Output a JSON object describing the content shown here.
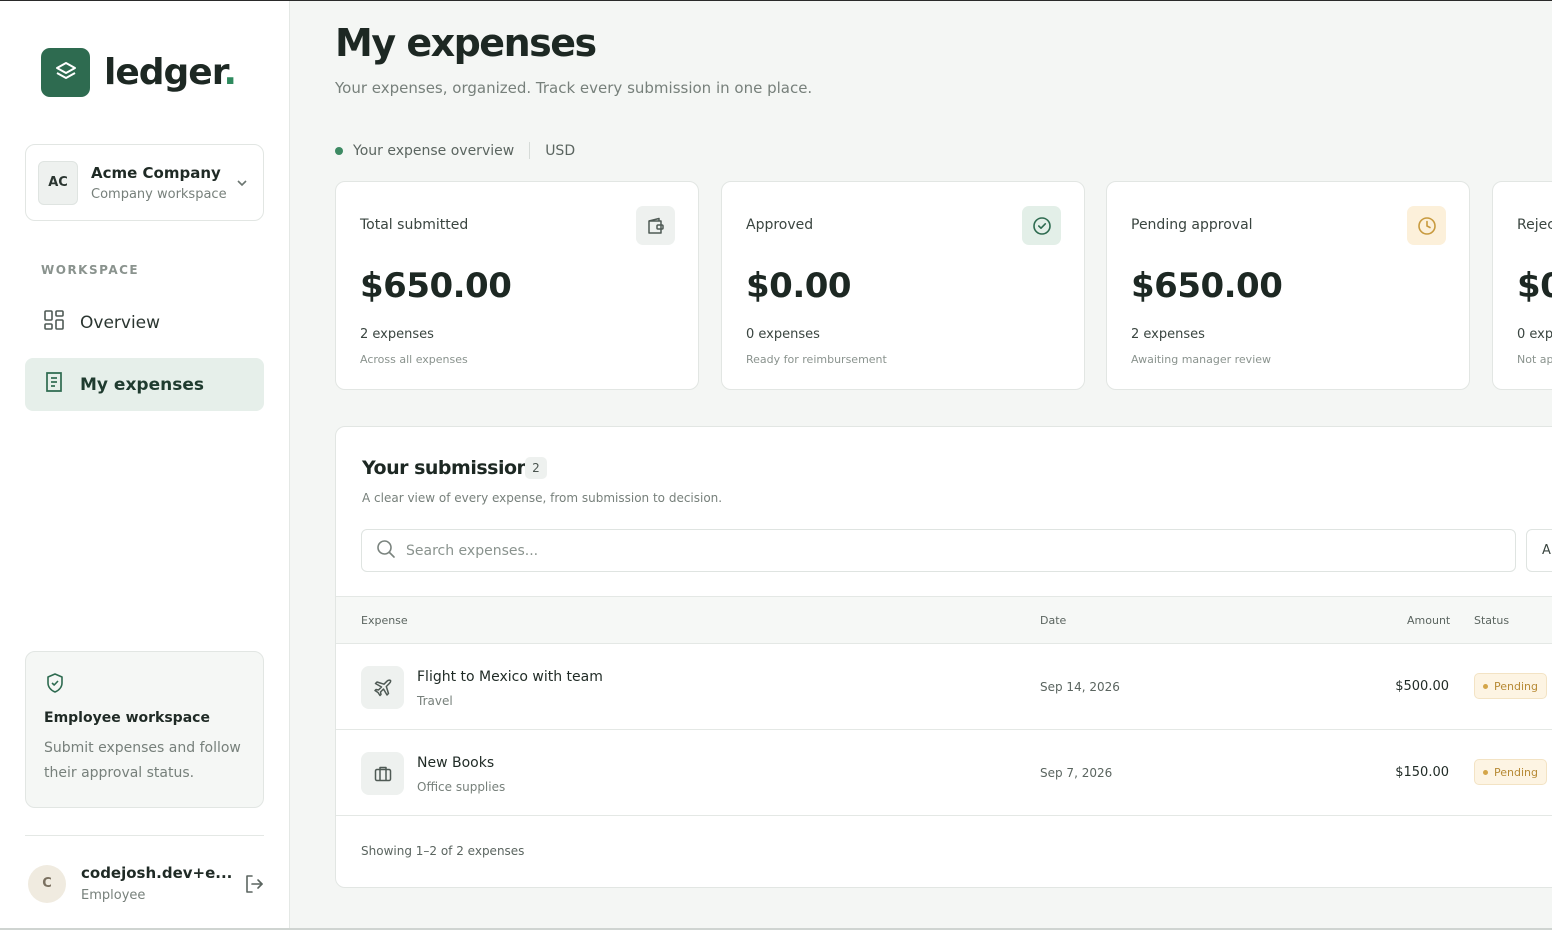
{
  "brand": {
    "name": "ledger",
    "dot": "."
  },
  "company": {
    "initials": "AC",
    "name": "Acme Company",
    "subtitle": "Company workspace"
  },
  "sidebar": {
    "section_label": "WORKSPACE",
    "items": [
      {
        "label": "Overview",
        "icon": "grid-icon",
        "active": false
      },
      {
        "label": "My expenses",
        "icon": "receipt-icon",
        "active": true
      }
    ],
    "info": {
      "title": "Employee workspace",
      "text": "Submit expenses and follow their approval status."
    }
  },
  "user": {
    "initial": "C",
    "name": "codejosh.dev+e...",
    "role": "Employee"
  },
  "page": {
    "title": "My expenses",
    "subtitle": "Your expenses, organized. Track every submission in one place.",
    "overview_label": "Your expense overview",
    "currency": "USD"
  },
  "stats": [
    {
      "label": "Total submitted",
      "value": "$650.00",
      "count": "2 expenses",
      "note": "Across all expenses",
      "icon": "wallet-icon",
      "icon_color": "#4f5a55",
      "icon_bg": "#eef1ef"
    },
    {
      "label": "Approved",
      "value": "$0.00",
      "count": "0 expenses",
      "note": "Ready for reimbursement",
      "icon": "check-circle-icon",
      "icon_color": "#2e6b50",
      "icon_bg": "#e3efe8"
    },
    {
      "label": "Pending approval",
      "value": "$650.00",
      "count": "2 expenses",
      "note": "Awaiting manager review",
      "icon": "clock-icon",
      "icon_color": "#c89a3e",
      "icon_bg": "#fcf0da"
    },
    {
      "label": "Rejec",
      "value": "$0",
      "count": "0 exp",
      "note": "Not ap",
      "icon": "",
      "icon_color": "",
      "icon_bg": ""
    }
  ],
  "submissions": {
    "title": "Your submissions",
    "count": "2",
    "subtitle": "A clear view of every expense, from submission to decision.",
    "search_placeholder": "Search expenses...",
    "filter_label": "Al",
    "columns": {
      "expense": "Expense",
      "date": "Date",
      "amount": "Amount",
      "status": "Status"
    },
    "rows": [
      {
        "title": "Flight to Mexico with team",
        "category": "Travel",
        "date": "Sep 14, 2026",
        "amount": "$500.00",
        "status": "Pending",
        "icon": "plane-icon"
      },
      {
        "title": "New Books",
        "category": "Office supplies",
        "date": "Sep 7, 2026",
        "amount": "$150.00",
        "status": "Pending",
        "icon": "briefcase-icon"
      }
    ],
    "footer": "Showing 1–2 of 2 expenses"
  },
  "colors": {
    "accent": "#2e6b50",
    "pending": "#b78a35"
  }
}
